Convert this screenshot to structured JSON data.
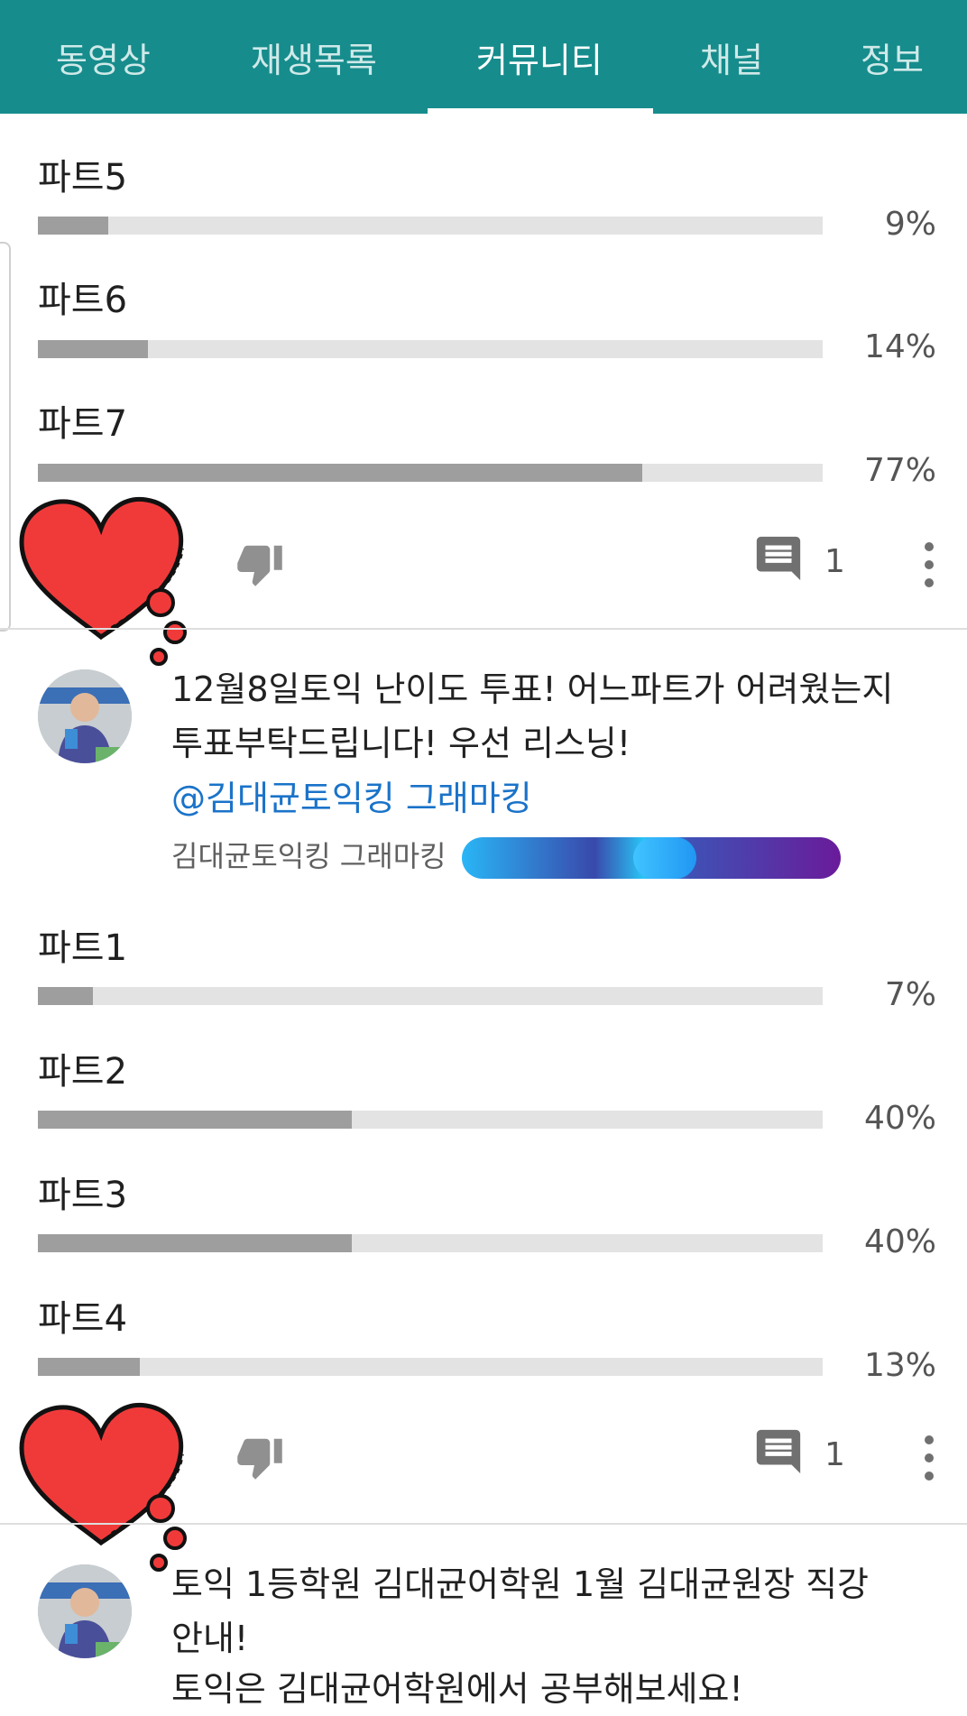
{
  "tabs": [
    {
      "label": "동영상",
      "active": false
    },
    {
      "label": "재생목록",
      "active": false
    },
    {
      "label": "커뮤니티",
      "active": true
    },
    {
      "label": "채널",
      "active": false
    },
    {
      "label": "정보",
      "active": false
    }
  ],
  "poll1": {
    "options": [
      {
        "label": "파트5",
        "percent_text": "9%",
        "percent": 9
      },
      {
        "label": "파트6",
        "percent_text": "14%",
        "percent": 14
      },
      {
        "label": "파트7",
        "percent_text": "77%",
        "percent": 77
      }
    ],
    "comment_count": "1"
  },
  "post2": {
    "text_line1": "12월8일토익 난이도 투표! 어느파트가 어려웠는지",
    "text_line2": "투표부탁드립니다! 우선 리스닝!",
    "mention": "@김대균토익킹 그래마킹",
    "author": "김대균토익킹 그래마킹",
    "poll": [
      {
        "label": "파트1",
        "percent_text": "7%",
        "percent": 7
      },
      {
        "label": "파트2",
        "percent_text": "40%",
        "percent": 40
      },
      {
        "label": "파트3",
        "percent_text": "40%",
        "percent": 40
      },
      {
        "label": "파트4",
        "percent_text": "13%",
        "percent": 13
      }
    ],
    "comment_count": "1"
  },
  "post3": {
    "text_line1": "토익 1등학원 김대균어학원 1월 김대균원장 직강",
    "text_line2": "안내!",
    "text_line3": "토익은 김대균어학원에서 공부해보세요!"
  },
  "colors": {
    "header": "#178c8c",
    "bar_fill": "#9e9e9e",
    "bar_track": "#e3e3e3",
    "link": "#1a73c9",
    "heart": "#f03a3a"
  },
  "icons": [
    "heart-sticker-icon",
    "dislike-icon",
    "comment-icon",
    "more-vert-icon"
  ]
}
